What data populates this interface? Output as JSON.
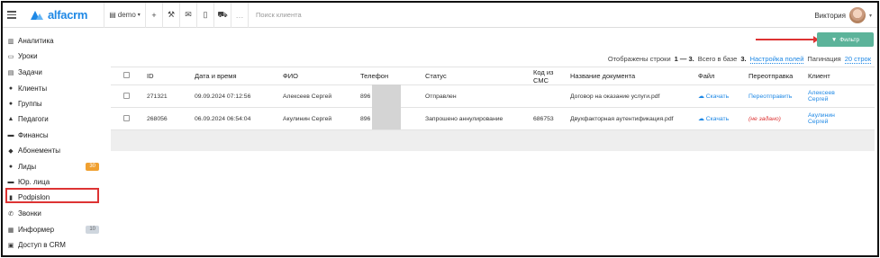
{
  "header": {
    "logo_text": "alfacrm",
    "branch": "demo",
    "search_placeholder": "Поиск клиента",
    "user_name": "Виктория"
  },
  "sidebar": {
    "items": [
      {
        "label": "Аналитика",
        "icon": "analytics-icon",
        "glyph": "▥"
      },
      {
        "label": "Уроки",
        "icon": "calendar-icon",
        "glyph": "▭"
      },
      {
        "label": "Задачи",
        "icon": "tasks-icon",
        "glyph": "▤"
      },
      {
        "label": "Клиенты",
        "icon": "user-icon",
        "glyph": "●"
      },
      {
        "label": "Группы",
        "icon": "users-icon",
        "glyph": "●"
      },
      {
        "label": "Педагоги",
        "icon": "graduation-cap-icon",
        "glyph": "▲"
      },
      {
        "label": "Финансы",
        "icon": "money-icon",
        "glyph": "▬"
      },
      {
        "label": "Абонементы",
        "icon": "tag-icon",
        "glyph": "◆"
      },
      {
        "label": "Лиды",
        "icon": "user-plus-icon",
        "glyph": "●",
        "badge": "30"
      },
      {
        "label": "Юр. лица",
        "icon": "briefcase-icon",
        "glyph": "▬"
      },
      {
        "label": "Podpislon",
        "icon": "file-icon",
        "glyph": "▮"
      },
      {
        "label": "Звонки",
        "icon": "phone-icon",
        "glyph": "✆"
      },
      {
        "label": "Информер",
        "icon": "informer-icon",
        "glyph": "▦",
        "badge": "10"
      },
      {
        "label": "Доступ в CRM",
        "icon": "lock-icon",
        "glyph": "▣"
      }
    ]
  },
  "toolbar": {
    "filter_label": "Фильтр"
  },
  "stats": {
    "shown_prefix": "Отображены строки",
    "range": "1 — 3.",
    "total_prefix": "Всего в базе",
    "total": "3.",
    "columns_link": "Настройка полей",
    "pagination_label": "Пагинация",
    "pagination_value": "20 строк"
  },
  "table": {
    "columns": [
      "ID",
      "Дата и время",
      "ФИО",
      "Телефон",
      "Статус",
      "Код из СМС",
      "Название документа",
      "Файл",
      "Переотправка",
      "Клиент"
    ],
    "rows": [
      {
        "id": "271321",
        "datetime": "09.09.2024 07:12:56",
        "name": "Алексеев Сергей",
        "phone": "896",
        "status": "Отправлен",
        "sms_code": "",
        "document": "Договор на оказание услуги.pdf",
        "file": "Скачать",
        "resend": "Переотправить",
        "client_first": "Алексеев",
        "client_second": "Сергей"
      },
      {
        "id": "268056",
        "datetime": "06.09.2024 06:54:04",
        "name": "Акулинин Сергей",
        "phone": "896",
        "status": "Запрошено аннулирование",
        "sms_code": "686753",
        "document": "Двухфакторная аутентификация.pdf",
        "file": "Скачать",
        "resend": "(не задано)",
        "client_first": "Акулинин",
        "client_second": "Сергей"
      }
    ]
  },
  "colors": {
    "accent": "#1e88e5",
    "filter_button": "#5cb39a",
    "annotation": "#dd3333",
    "badge_orange": "#f0a030"
  }
}
